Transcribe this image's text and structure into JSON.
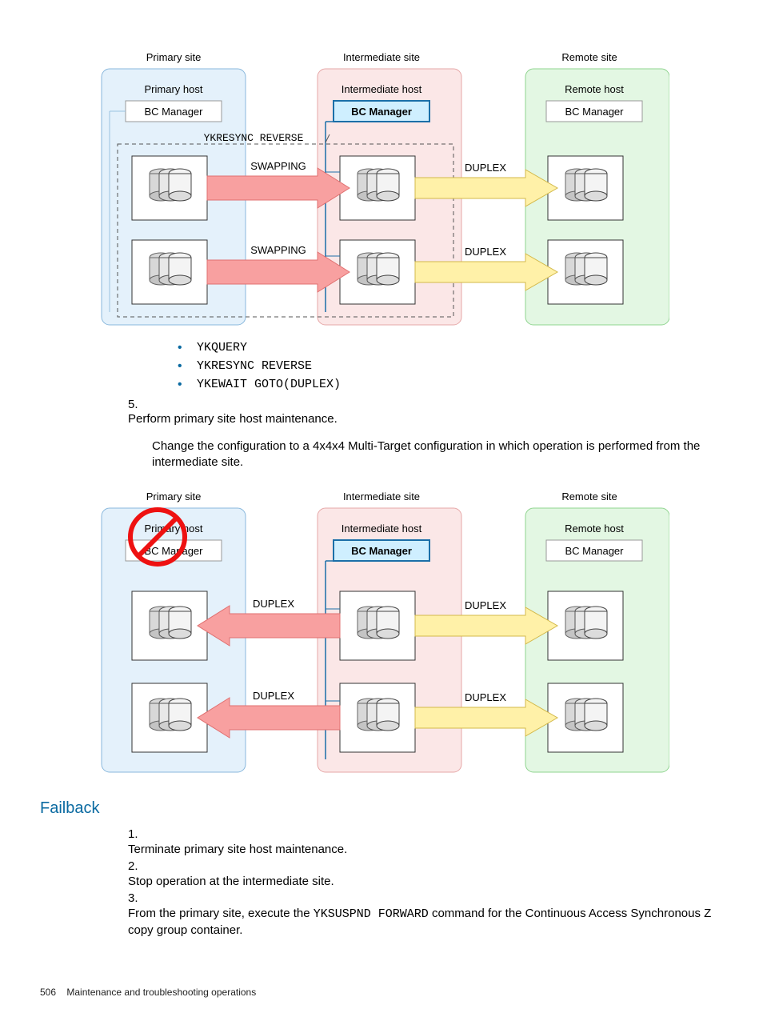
{
  "diagram1": {
    "titles": {
      "primary": "Primary site",
      "intermediate": "Intermediate site",
      "remote": "Remote site"
    },
    "hosts": {
      "primary": "Primary host",
      "intermediate": "Intermediate host",
      "remote": "Remote host"
    },
    "bc": {
      "primary": "BC Manager",
      "intermediate": "BC Manager",
      "remote": "BC Manager"
    },
    "cmd": "YKRESYNC REVERSE",
    "arrows": {
      "a1": "SWAPPING",
      "a2": "SWAPPING",
      "b1": "DUPLEX",
      "b2": "DUPLEX"
    }
  },
  "bullets": [
    "YKQUERY",
    "YKRESYNC REVERSE",
    "YKEWAIT GOTO(DUPLEX)"
  ],
  "step5": {
    "num": "5.",
    "line1": "Perform primary site host maintenance.",
    "body": "Change the configuration to a 4x4x4 Multi-Target configuration in which operation is performed from the intermediate site."
  },
  "diagram2": {
    "titles": {
      "primary": "Primary site",
      "intermediate": "Intermediate site",
      "remote": "Remote site"
    },
    "hosts": {
      "primary": "Primary host",
      "intermediate": "Intermediate host",
      "remote": "Remote host"
    },
    "bc": {
      "primary": "BC Manager",
      "intermediate": "BC Manager",
      "remote": "BC Manager"
    },
    "arrows": {
      "a1": "DUPLEX",
      "a2": "DUPLEX",
      "b1": "DUPLEX",
      "b2": "DUPLEX"
    }
  },
  "heading": "Failback",
  "failback": {
    "n1": "1.",
    "t1": "Terminate primary site host maintenance.",
    "n2": "2.",
    "t2": "Stop operation at the intermediate site.",
    "n3": "3.",
    "t3a": "From the primary site, execute the ",
    "t3cmd": "YKSUSPND FORWARD",
    "t3b": " command for the Continuous Access Synchronous Z copy group container."
  },
  "footer": {
    "page": "506",
    "title": "Maintenance and troubleshooting operations"
  }
}
